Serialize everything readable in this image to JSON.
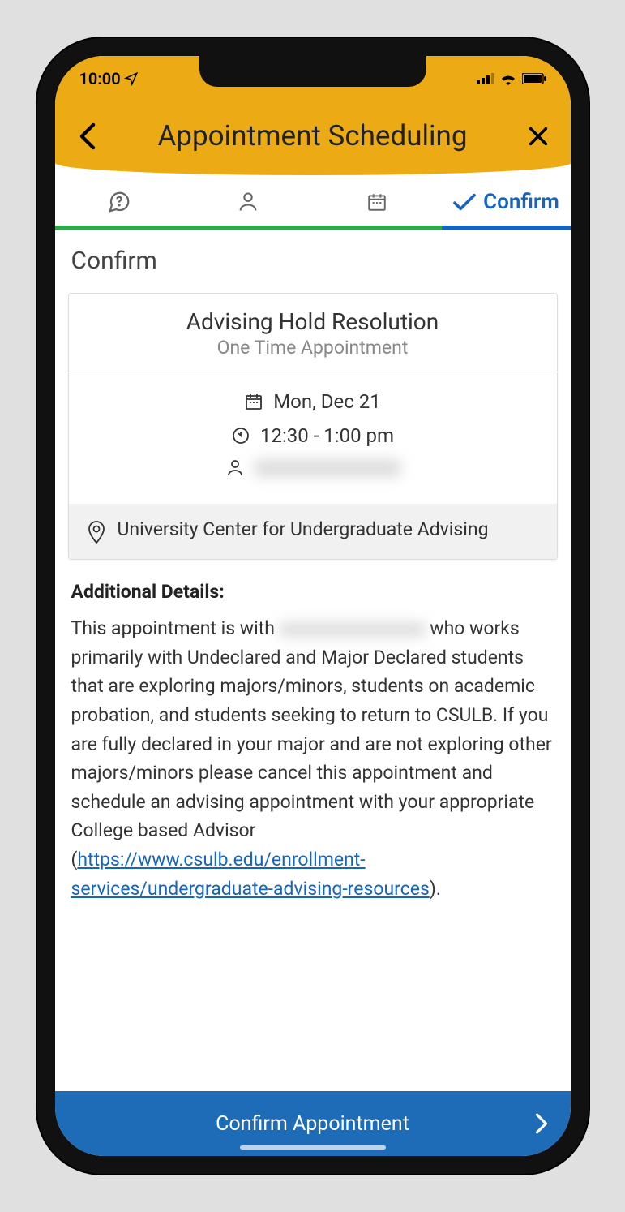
{
  "statusBar": {
    "time": "10:00"
  },
  "header": {
    "title": "Appointment Scheduling"
  },
  "stepper": {
    "confirmLabel": "Confirm"
  },
  "section": {
    "title": "Confirm"
  },
  "appointment": {
    "title": "Advising Hold Resolution",
    "subtitle": "One Time Appointment",
    "date": "Mon, Dec 21",
    "time": "12:30 - 1:00 pm",
    "location": "University Center for Undergraduate Advising"
  },
  "details": {
    "heading": "Additional Details:",
    "prefix": "This appointment is with ",
    "body": " who works primarily with Undeclared and Major Declared students that are exploring majors/minors, students on academic probation, and students seeking to return to CSULB. If you are fully declared in your major and are not exploring other majors/minors please cancel this appointment and schedule an advising appointment with your appropriate College based Advisor (",
    "linkText": "https://www.csulb.edu/enrollment-services/undergraduate-advising-resources",
    "suffix": ")."
  },
  "footer": {
    "confirmButton": "Confirm Appointment"
  }
}
